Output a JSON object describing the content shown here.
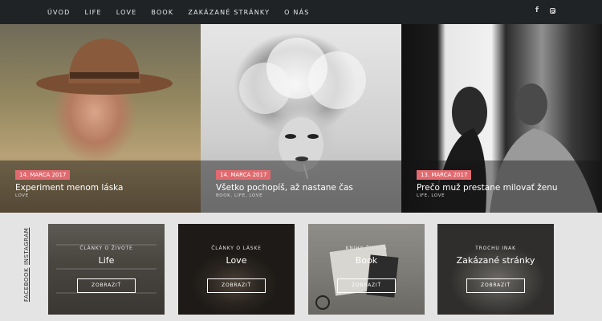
{
  "nav": {
    "items": [
      {
        "label": "ÚVOD"
      },
      {
        "label": "LIFE"
      },
      {
        "label": "LOVE"
      },
      {
        "label": "BOOK"
      },
      {
        "label": "ZAKÁZANÉ STRÁNKY"
      },
      {
        "label": "O NÁS"
      }
    ],
    "social": {
      "facebook_icon": "f",
      "instagram_icon": "instagram-icon"
    }
  },
  "hero": [
    {
      "date": "14. MARCA 2017",
      "title": "Experiment menom láska",
      "tags": "LOVE"
    },
    {
      "date": "14. MARCA 2017",
      "title": "Všetko pochopíš, až nastane čas",
      "tags": "BOOK, LIFE, LOVE"
    },
    {
      "date": "13. MARCA 2017",
      "title": "Prečo muž prestane milovať ženu",
      "tags": "LIFE, LOVE"
    }
  ],
  "side_social": {
    "instagram": "INSTAGRAM",
    "facebook": "FACEBOOK"
  },
  "categories": [
    {
      "subtitle": "ČLÁNKY O ŽIVOTE",
      "title": "Life",
      "button": "ZOBRAZIŤ"
    },
    {
      "subtitle": "ČLÁNKY O LÁSKE",
      "title": "Love",
      "button": "ZOBRAZIŤ"
    },
    {
      "subtitle": "KNIHY ŽIVOTA",
      "title": "Book",
      "button": "ZOBRAZIŤ"
    },
    {
      "subtitle": "TROCHU INAK",
      "title": "Zakázané stránky",
      "button": "ZOBRAZIŤ"
    }
  ],
  "colors": {
    "nav_bg": "#1f2326",
    "accent": "#e06a6f",
    "page_bg": "#e4e4e4"
  }
}
